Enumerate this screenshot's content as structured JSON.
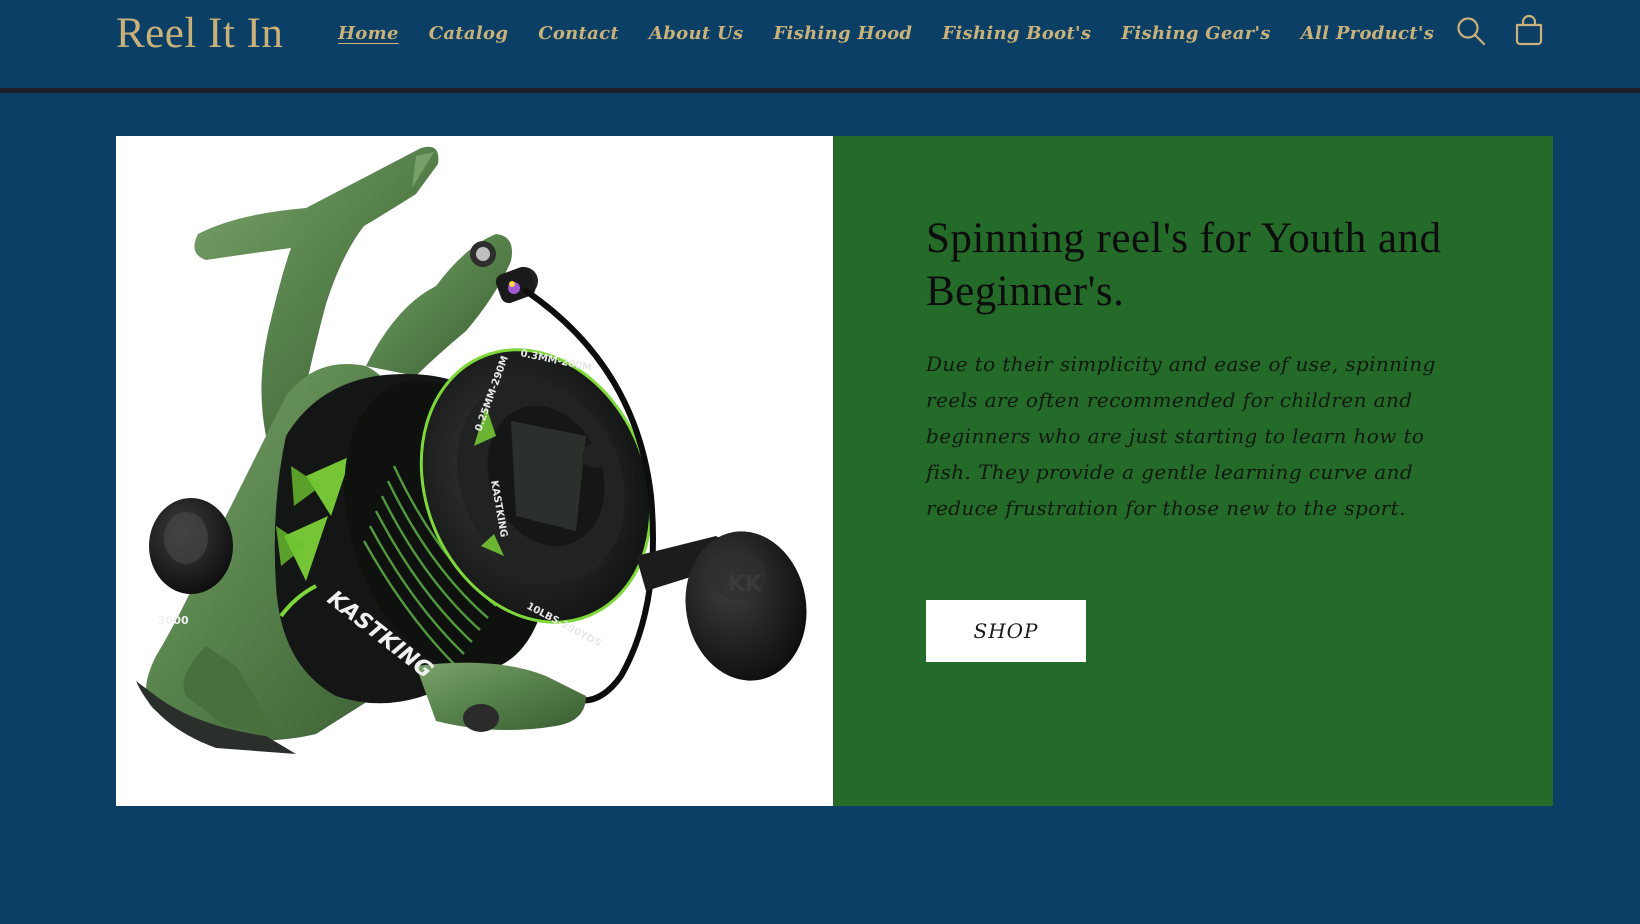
{
  "header": {
    "logo": "Reel It In",
    "nav": [
      {
        "label": "Home",
        "active": true
      },
      {
        "label": "Catalog"
      },
      {
        "label": "Contact"
      },
      {
        "label": "About Us"
      },
      {
        "label": "Fishing Hood"
      },
      {
        "label": "Fishing Boot's"
      },
      {
        "label": "Fishing Gear's"
      },
      {
        "label": "All Product's"
      }
    ],
    "icons": {
      "search": "search-icon",
      "cart": "cart-icon"
    }
  },
  "hero": {
    "image": {
      "subject": "spinning-reel",
      "reel_labels": {
        "size": "3000",
        "brand": "KASTKING",
        "spool_line_1": "0.25MM-290M",
        "spool_line_2": "0.3MM-200M",
        "spool_line_3": "10LBS-290YDS",
        "handle_logo": "KK"
      }
    },
    "heading": "Spinning reel's for Youth and Beginner's.",
    "text": "Due to their simplicity and ease of use, spinning reels are often recommended for children and beginners who are just starting to learn how to fish. They provide a gentle learning curve and reduce frustration for those new to the sport.",
    "button_label": "SHOP"
  },
  "colors": {
    "page_background": "#0b3f66",
    "brand_gold": "#c9b27a",
    "header_rule": "#1b1f24",
    "panel_green": "#246a29",
    "reel_green": "#5d8a4f",
    "accent_lime": "#7fd83a"
  }
}
